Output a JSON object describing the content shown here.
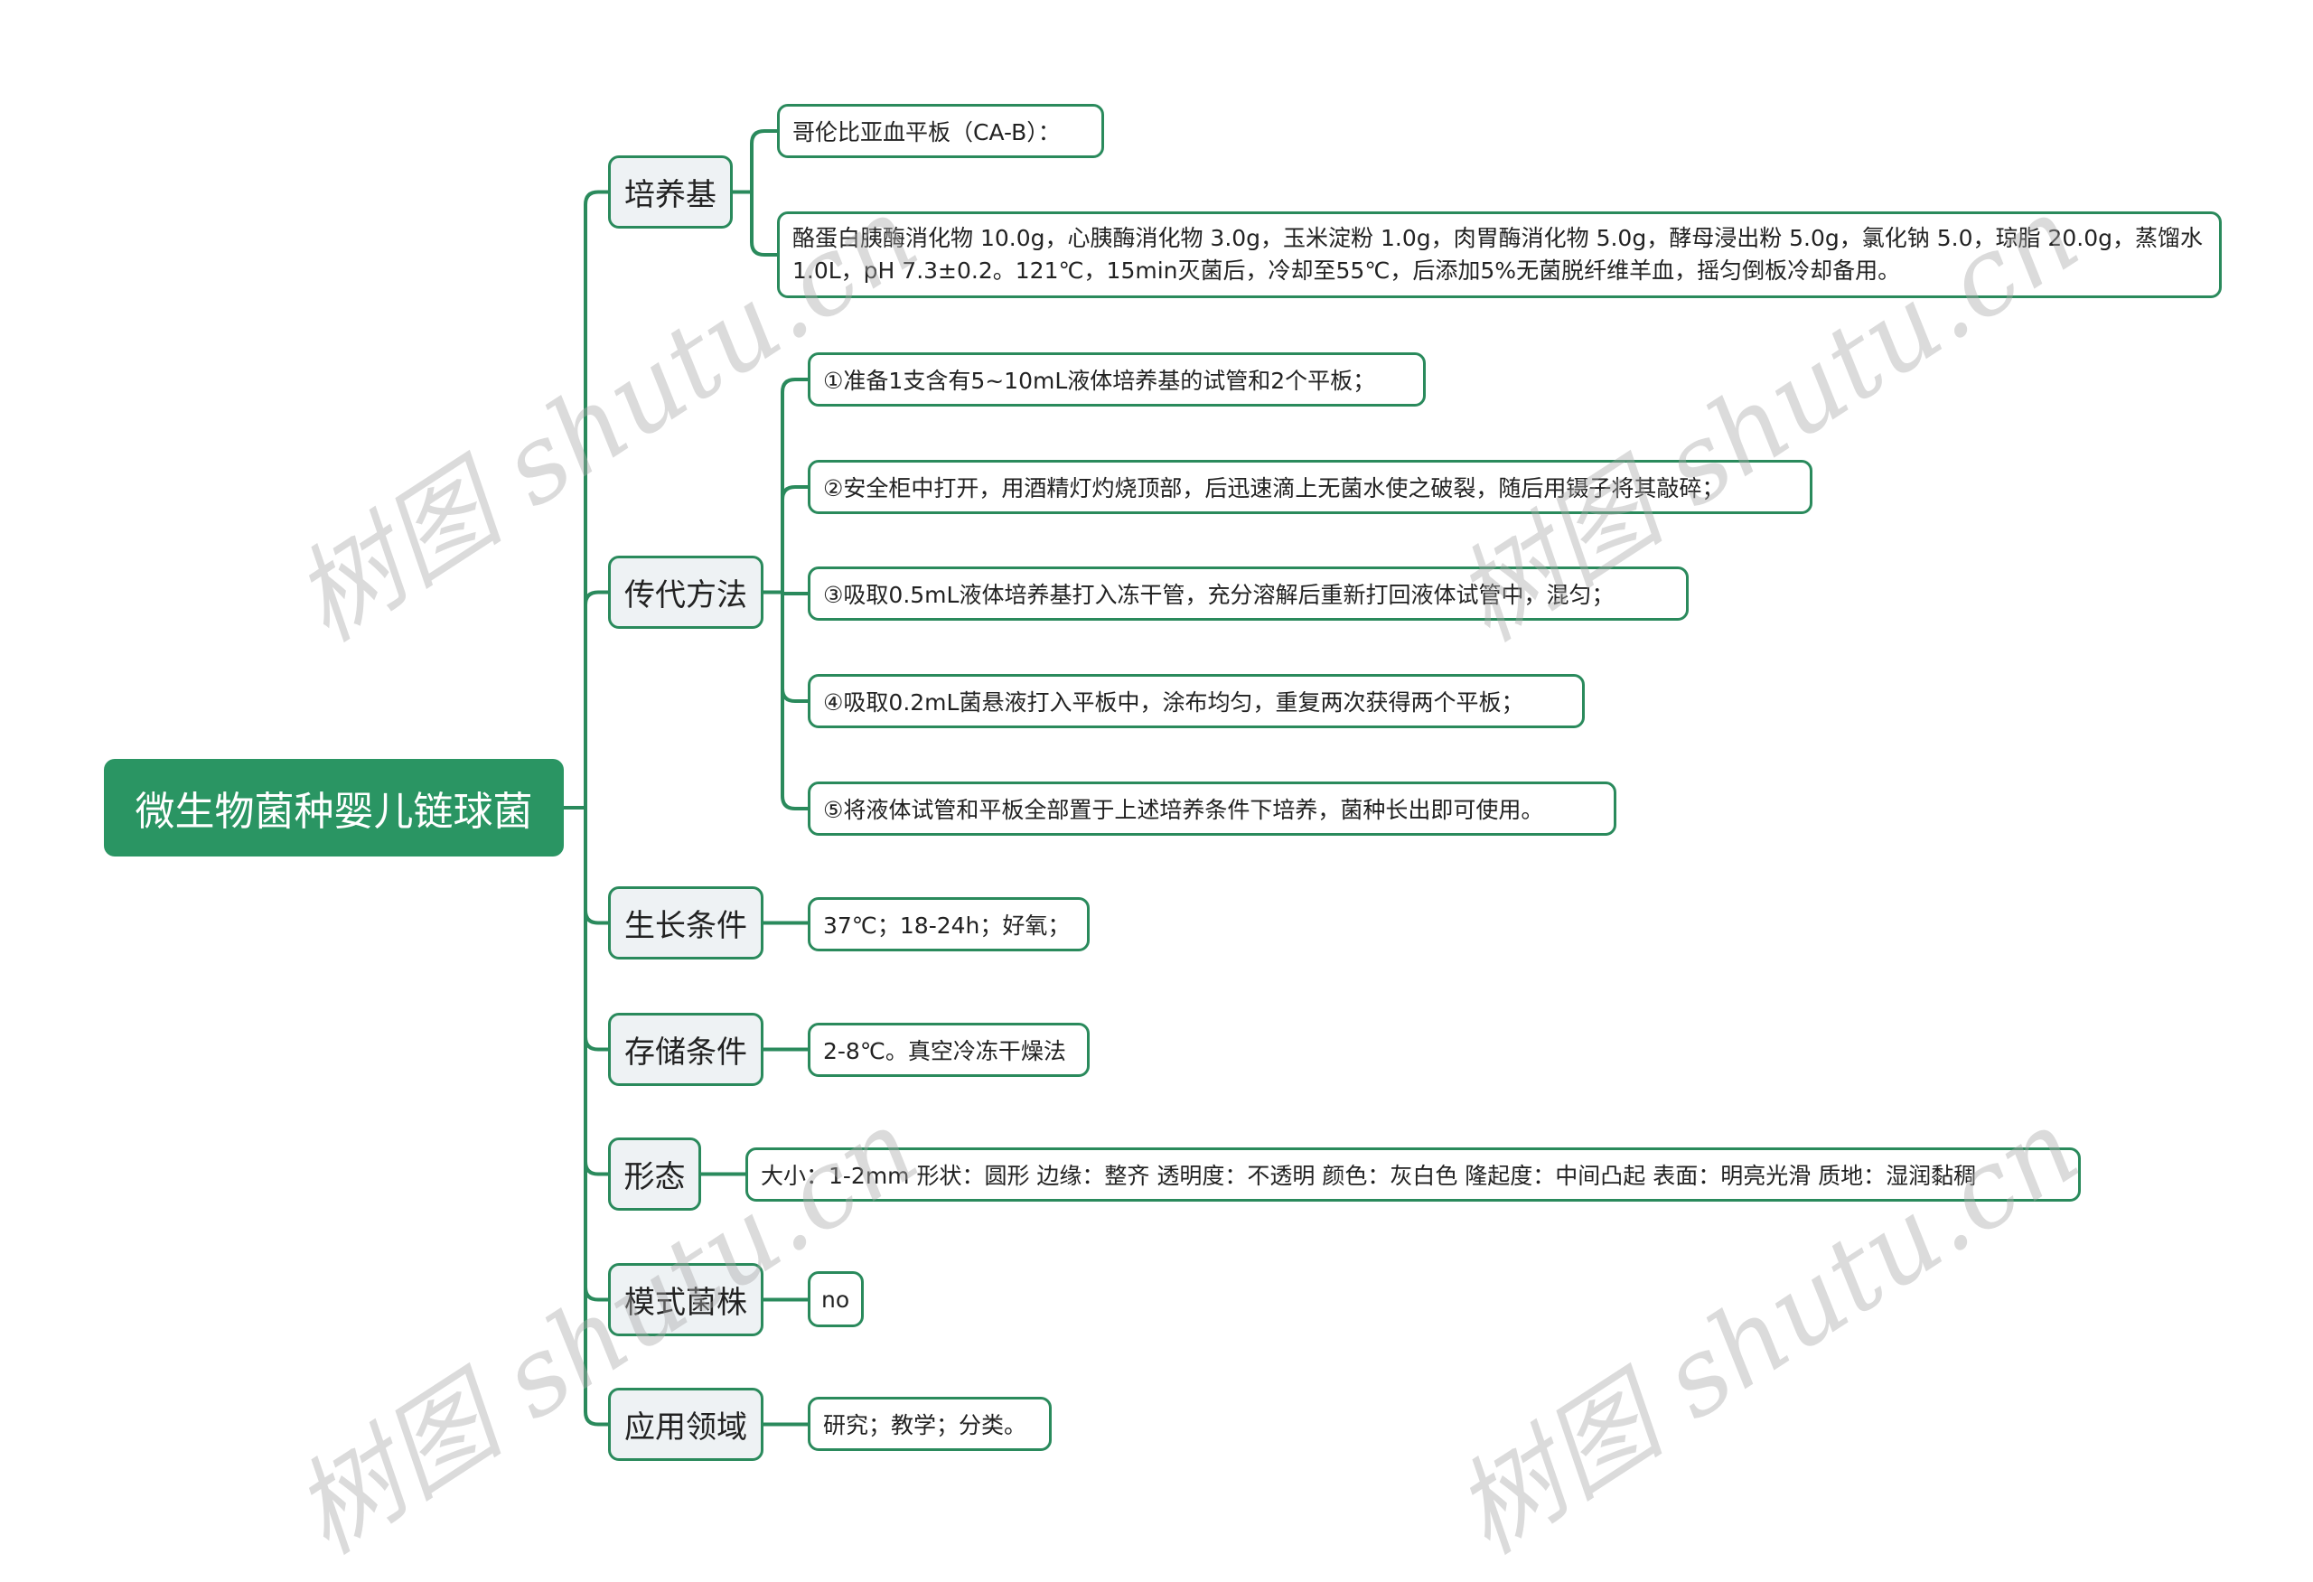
{
  "root": {
    "label": "微生物菌种婴儿链球菌"
  },
  "branches": [
    {
      "label": "培养基",
      "children": [
        "哥伦比亚血平板（CA-B）：",
        "酪蛋白胰酶消化物 10.0g，心胰酶消化物 3.0g，玉米淀粉 1.0g，肉胃酶消化物 5.0g，酵母浸出粉 5.0g，氯化钠 5.0，琼脂 20.0g，蒸馏水 1.0L，pH 7.3±0.2。121℃，15min灭菌后，冷却至55℃，后添加5%无菌脱纤维羊血，摇匀倒板冷却备用。"
      ]
    },
    {
      "label": "传代方法",
      "children": [
        "①准备1支含有5~10mL液体培养基的试管和2个平板；",
        "②安全柜中打开，用酒精灯灼烧顶部，后迅速滴上无菌水使之破裂，随后用镊子将其敲碎；",
        "③吸取0.5mL液体培养基打入冻干管，充分溶解后重新打回液体试管中，混匀；",
        "④吸取0.2mL菌悬液打入平板中，涂布均匀，重复两次获得两个平板；",
        "⑤将液体试管和平板全部置于上述培养条件下培养，菌种长出即可使用。"
      ]
    },
    {
      "label": "生长条件",
      "children": [
        "37℃；18-24h；好氧；"
      ]
    },
    {
      "label": "存储条件",
      "children": [
        "2-8℃。真空冷冻干燥法"
      ]
    },
    {
      "label": "形态",
      "children": [
        "大小：1-2mm 形状：圆形 边缘：整齐 透明度：不透明 颜色：灰白色 隆起度：中间凸起 表面：明亮光滑 质地：湿润黏稠"
      ]
    },
    {
      "label": "模式菌株",
      "children": [
        "no"
      ]
    },
    {
      "label": "应用领域",
      "children": [
        "研究；教学；分类。"
      ]
    }
  ],
  "watermark": "树图 shutu.cn",
  "colors": {
    "accent": "#2a9563",
    "line": "#2a8a5c",
    "branch_bg": "#eef2f4"
  }
}
